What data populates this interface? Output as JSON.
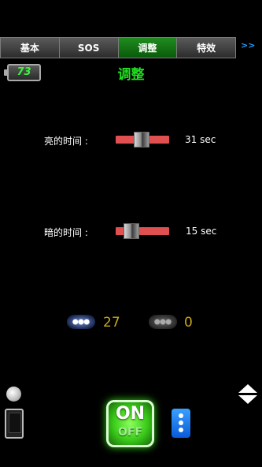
{
  "tabs": [
    {
      "label": "基本"
    },
    {
      "label": "SOS"
    },
    {
      "label": "调整"
    },
    {
      "label": "特效"
    }
  ],
  "tabs_more": ">>",
  "battery": {
    "value": "73"
  },
  "title": "调整",
  "settings": {
    "on_time": {
      "label": "亮的时间 :",
      "value": "31 sec",
      "fraction": 0.47
    },
    "off_time": {
      "label": "暗的时间 :",
      "value": "15 sec",
      "fraction": 0.2
    }
  },
  "counters": {
    "on_count": "27",
    "off_count": "0"
  },
  "buttons": {
    "onoff_on": "ON",
    "onoff_off": "OFF"
  },
  "colors": {
    "active_tab": "#0a6a0a",
    "title": "#22e022",
    "slider": "#e05050",
    "count": "#c8a818",
    "menu": "#0a5ad8"
  }
}
